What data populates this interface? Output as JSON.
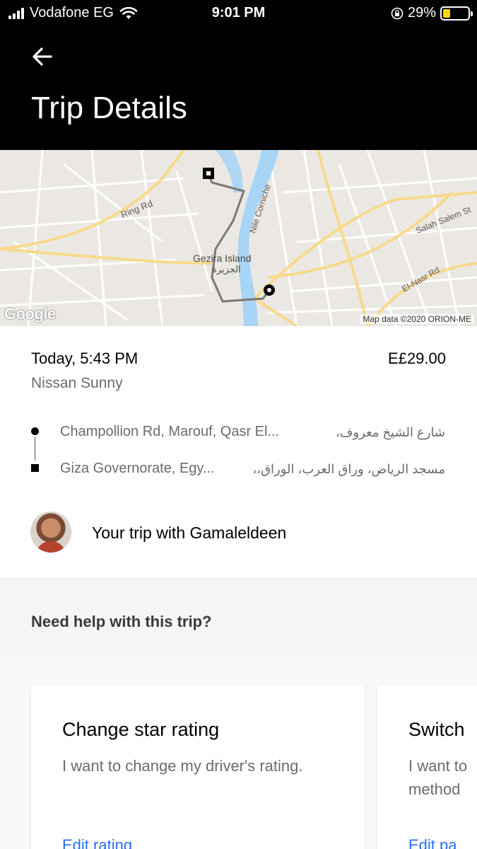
{
  "status_bar": {
    "carrier": "Vodafone EG",
    "time": "9:01 PM",
    "battery": "29%",
    "battery_level": 0.29
  },
  "header": {
    "back_icon": "arrow-left-icon",
    "title": "Trip Details"
  },
  "map": {
    "labels": {
      "ring_rd": "Ring Rd",
      "nile_corniche": "Nile Corniche",
      "salah_salem": "Salah Salem St",
      "el_nasr": "El-Nasr Rd",
      "gezira_en": "Gezira Island",
      "gezira_ar": "الجزيرة"
    },
    "logo": "Google",
    "credit": "Map data ©2020 ORION-ME"
  },
  "trip": {
    "date": "Today, 5:43 PM",
    "price": "E£29.00",
    "car": "Nissan Sunny",
    "pickup": "Champollion Rd, Marouf, Qasr El...",
    "pickup_ar": "شارع الشيخ معروف،",
    "dropoff": "Giza Governorate, Egy...",
    "dropoff_ar": "مسجد الرياض، وراق العرب، الوراق،،"
  },
  "driver": {
    "text": "Your trip with Gamaleldeen"
  },
  "help": {
    "title": "Need help with this trip?",
    "cards": [
      {
        "title": "Change star rating",
        "description": "I want to change my driver's rating.",
        "link": "Edit rating"
      },
      {
        "title": "Switch",
        "description": "I want to method",
        "link": "Edit pa"
      }
    ]
  },
  "colors": {
    "header_bg": "#000000",
    "link": "#276ef1",
    "map_bg": "#ebe8e3",
    "water": "#a8d4f5",
    "road_major": "#f7d98a"
  }
}
